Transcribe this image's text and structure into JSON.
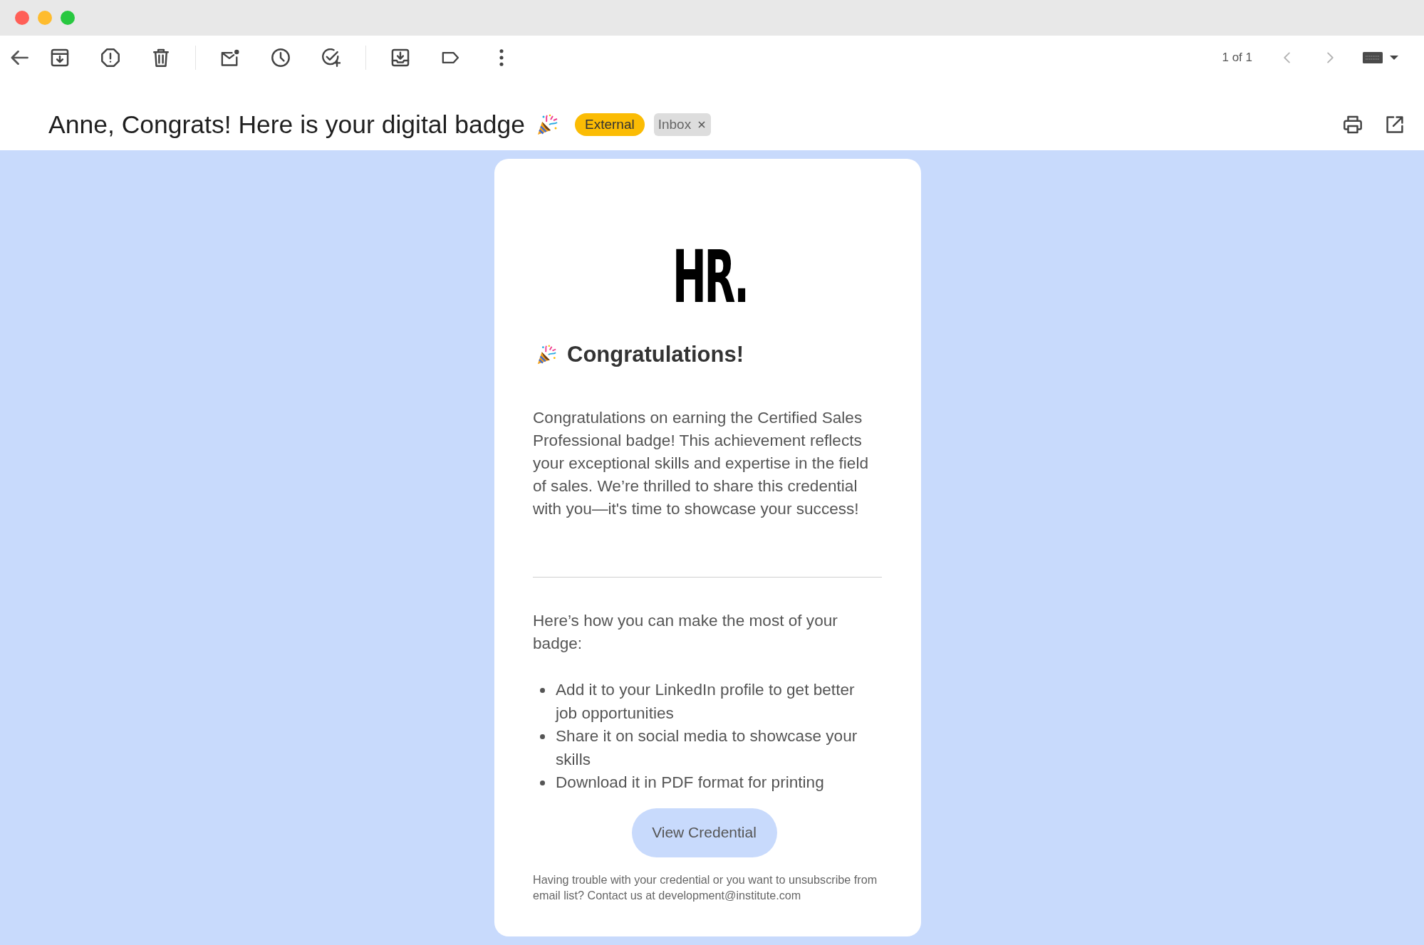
{
  "window": {
    "controls": [
      {
        "color": "#ff5f57"
      },
      {
        "color": "#febc2e"
      },
      {
        "color": "#28c840"
      }
    ]
  },
  "toolbar": {
    "pager": {
      "text": "1 of 1",
      "previous": {
        "disabled": true
      },
      "next": {
        "disabled": true
      }
    }
  },
  "subject": {
    "title": "Anne, Congrats! Here is your digital badge",
    "labels": [
      {
        "text": "External",
        "color": "#fbbc04",
        "removable": false
      },
      {
        "text": "Inbox",
        "color": "#dddddd",
        "removable": true
      }
    ]
  },
  "message": {
    "logo": "HR.",
    "heading": "Congratulations!",
    "paragraph": "Congratulations on earning the Certified Sales Professional badge! This achievement reflects your exceptional skills and expertise in the field of sales. We’re thrilled to share this credential with you—it's time to showcase your success!",
    "intro": "Here’s how you can make the most of your badge:",
    "tips": [
      "Add it to your LinkedIn profile to get better job opportunities",
      "Share it on social media to showcase your skills",
      "Download it in PDF format for printing"
    ],
    "button": "View Credential",
    "footer": {
      "text": "Having trouble with your credential or you want to unsubscribe from email list? Contact us at",
      "email": "development@institute.com"
    }
  }
}
